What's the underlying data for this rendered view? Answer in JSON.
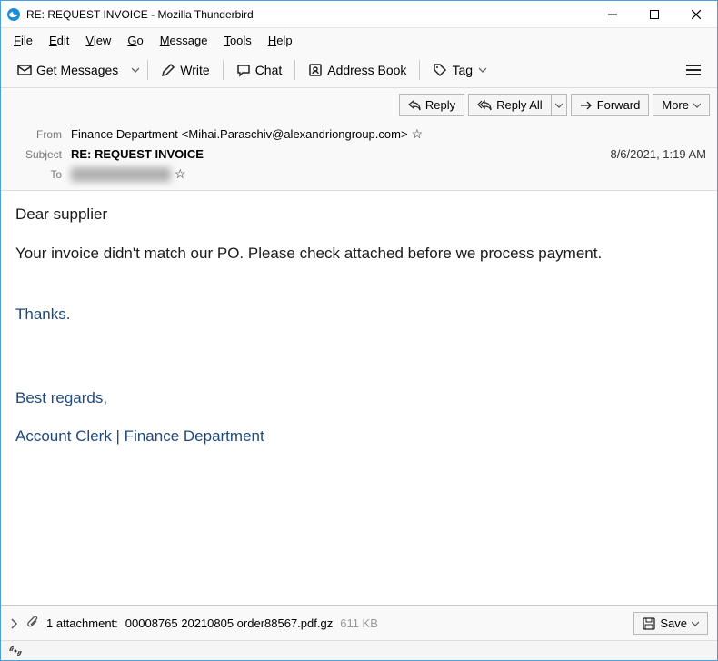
{
  "window": {
    "title": "RE: REQUEST INVOICE - Mozilla Thunderbird"
  },
  "menu": {
    "file": "File",
    "edit": "Edit",
    "view": "View",
    "go": "Go",
    "message": "Message",
    "tools": "Tools",
    "help": "Help"
  },
  "toolbar": {
    "get": "Get Messages",
    "write": "Write",
    "chat": "Chat",
    "addressbook": "Address Book",
    "tag": "Tag"
  },
  "actions": {
    "reply": "Reply",
    "replyall": "Reply All",
    "forward": "Forward",
    "more": "More"
  },
  "headers": {
    "from_label": "From",
    "from_name": "Finance Department",
    "from_email": "<Mihai.Paraschiv@alexandriongroup.com>",
    "subject_label": "Subject",
    "subject": "RE: REQUEST INVOICE",
    "date": "8/6/2021, 1:19 AM",
    "to_label": "To"
  },
  "body": {
    "p1": "Dear supplier",
    "p2": "Your invoice didn't match our PO. Please check attached before we process payment.",
    "p3": "Thanks.",
    "p4": "Best regards,",
    "p5": "Account Clerk | Finance Department"
  },
  "attachment": {
    "count_text": "1 attachment:",
    "filename": "00008765 20210805 order88567.pdf.gz",
    "size": "611 KB",
    "save": "Save"
  }
}
